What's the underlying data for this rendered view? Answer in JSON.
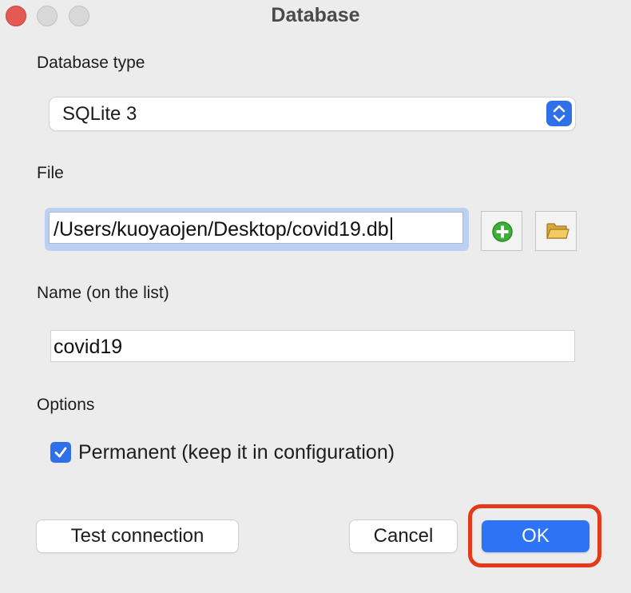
{
  "window": {
    "title": "Database"
  },
  "database_type": {
    "label": "Database type",
    "selected": "SQLite 3"
  },
  "file": {
    "label": "File",
    "value": "/Users/kuoyaojen/Desktop/covid19.db",
    "add_icon": "plus-circle-icon",
    "browse_icon": "folder-icon"
  },
  "name": {
    "label": "Name (on the list)",
    "value": "covid19"
  },
  "options": {
    "label": "Options",
    "permanent_label": "Permanent (keep it in configuration)",
    "permanent_checked": true
  },
  "buttons": {
    "test_connection": "Test connection",
    "cancel": "Cancel",
    "ok": "OK"
  },
  "colors": {
    "accent": "#2c74f5",
    "highlight": "#e43a1c",
    "close": "#e35a55"
  }
}
